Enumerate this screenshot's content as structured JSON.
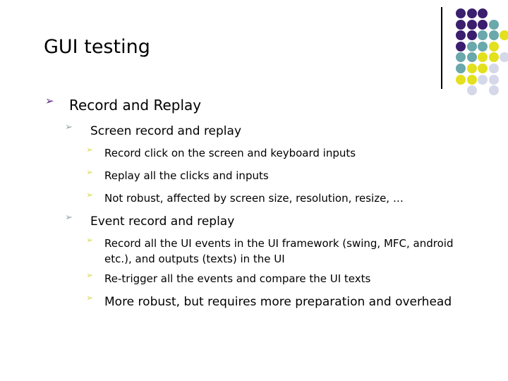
{
  "slide": {
    "title": "GUI testing",
    "background": "#ffffff",
    "title_color": "#000000"
  },
  "bullet_glyph": "➢",
  "bullet_colors": {
    "level1": "#5b2a86",
    "level2": "#8fa3a8",
    "level3": "#d8d84a"
  },
  "outline": [
    {
      "level": 1,
      "text": "Record and Replay"
    },
    {
      "level": 2,
      "text": "Screen record and replay"
    },
    {
      "level": 3,
      "text": "Record click on the screen and keyboard inputs"
    },
    {
      "level": 3,
      "text": "Replay all the clicks and inputs"
    },
    {
      "level": 3,
      "text": "Not robust, affected by screen size, resolution, resize, …"
    },
    {
      "level": 2,
      "text": "Event record and replay"
    },
    {
      "level": 3,
      "text": "Record all the UI events in the UI framework (swing, MFC, android etc.), and outputs (texts) in the UI"
    },
    {
      "level": 3,
      "text": "Re-trigger all the events and compare the UI texts"
    },
    {
      "level": 3,
      "text": "More robust, but requires more preparation and overhead"
    }
  ],
  "decoration": {
    "name": "dot-grid-motif",
    "rule_color": "#000000",
    "palette": {
      "purple": "#3b1e6e",
      "teal": "#6aa8ab",
      "yellow": "#e3e01e",
      "lavender": "#d5d8e8"
    },
    "dots": [
      {
        "col": 0,
        "row": 0,
        "color": "#3b1e6e"
      },
      {
        "col": 1,
        "row": 0,
        "color": "#3b1e6e"
      },
      {
        "col": 2,
        "row": 0,
        "color": "#3b1e6e"
      },
      {
        "col": 0,
        "row": 1,
        "color": "#3b1e6e"
      },
      {
        "col": 1,
        "row": 1,
        "color": "#3b1e6e"
      },
      {
        "col": 2,
        "row": 1,
        "color": "#3b1e6e"
      },
      {
        "col": 3,
        "row": 1,
        "color": "#6aa8ab"
      },
      {
        "col": 0,
        "row": 2,
        "color": "#3b1e6e"
      },
      {
        "col": 1,
        "row": 2,
        "color": "#3b1e6e"
      },
      {
        "col": 2,
        "row": 2,
        "color": "#6aa8ab"
      },
      {
        "col": 3,
        "row": 2,
        "color": "#6aa8ab"
      },
      {
        "col": 4,
        "row": 2,
        "color": "#e3e01e"
      },
      {
        "col": 0,
        "row": 3,
        "color": "#3b1e6e"
      },
      {
        "col": 1,
        "row": 3,
        "color": "#6aa8ab"
      },
      {
        "col": 2,
        "row": 3,
        "color": "#6aa8ab"
      },
      {
        "col": 3,
        "row": 3,
        "color": "#e3e01e"
      },
      {
        "col": 0,
        "row": 4,
        "color": "#6aa8ab"
      },
      {
        "col": 1,
        "row": 4,
        "color": "#6aa8ab"
      },
      {
        "col": 2,
        "row": 4,
        "color": "#e3e01e"
      },
      {
        "col": 3,
        "row": 4,
        "color": "#e3e01e"
      },
      {
        "col": 4,
        "row": 4,
        "color": "#d5d8e8"
      },
      {
        "col": 0,
        "row": 5,
        "color": "#6aa8ab"
      },
      {
        "col": 1,
        "row": 5,
        "color": "#e3e01e"
      },
      {
        "col": 2,
        "row": 5,
        "color": "#e3e01e"
      },
      {
        "col": 3,
        "row": 5,
        "color": "#d5d8e8"
      },
      {
        "col": 0,
        "row": 6,
        "color": "#e3e01e"
      },
      {
        "col": 1,
        "row": 6,
        "color": "#e3e01e"
      },
      {
        "col": 2,
        "row": 6,
        "color": "#d5d8e8"
      },
      {
        "col": 3,
        "row": 6,
        "color": "#d5d8e8"
      },
      {
        "col": 1,
        "row": 7,
        "color": "#d5d8e8"
      },
      {
        "col": 3,
        "row": 7,
        "color": "#d5d8e8"
      }
    ]
  }
}
